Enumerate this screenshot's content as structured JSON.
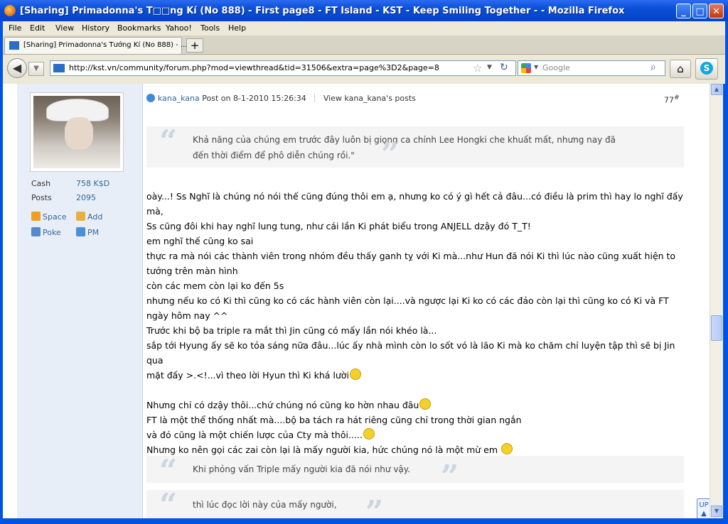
{
  "window": {
    "title": "[Sharing] Primadonna's T□□ng Kí (No 888) - First page8 - FT Island - KST - Keep Smiling Together - - Mozilla Firefox",
    "minimize": "_",
    "maximize": "□",
    "close": "✕"
  },
  "menu": [
    "File",
    "Edit",
    "View",
    "History",
    "Bookmarks",
    "Yahoo!",
    "Tools",
    "Help"
  ],
  "tab": {
    "label": "[Sharing] Primadonna's Tướng Kí (No 888) - ...",
    "new_tab": "+"
  },
  "nav": {
    "url": "http://kst.vn/community/forum.php?mod=viewthread&tid=31506&extra=page%3D2&page=8",
    "search_placeholder": "Google"
  },
  "sidebar": {
    "cash_label": "Cash",
    "cash_value": "758 K$D",
    "posts_label": "Posts",
    "posts_value": "2095",
    "links": [
      "Space",
      "Add",
      "Poke",
      "PM"
    ]
  },
  "post": {
    "author": "kana_kana",
    "posted": "Post on 8-1-2010 15:26:34",
    "view_posts": "View kana_kana's posts",
    "number": "77",
    "number_sup": "#",
    "quote1": [
      "Khả năng của chúng em trước đây luôn bị giọng ca chính Lee Hongki che khuất mất, nhưng nay đã",
      "đến thời điểm để phô diễn chúng rồi.\""
    ],
    "lines": [
      "oày...! Ss Nghĩ là chúng nó nói thế cũng đúng thôi em ạ, nhưng ko có ý gì hết cả đâu...có điều là prim thì hay lo nghĩ đấy",
      "mà,",
      "Ss cũng đôi khi hay nghĩ lung tung, như cái lần Ki phát biểu trong ANJELL dzậy đó T_T!",
      "em nghĩ thế cũng ko sai",
      "thực ra mà nói các thành viên trong nhóm đều thấy ganh tỵ với Ki mà...như Hun đã nói Ki thì lúc nào cũng xuất hiện to",
      "tướng trên màn hình",
      "còn các mem còn lại ko đến 5s",
      "nhưng nếu ko có Ki thì cũng ko có các hành viên còn lại....và ngược lại Ki ko có các đảo còn lại thì cũng ko có Ki và FT",
      "ngày hôm nay ^^",
      "Trước khi bộ ba triple ra mắt thì Jin cũng có mấy lần nói khéo là...",
      "sắp tới Hyung ấy sẽ ko tỏa sáng nữa đâu...lúc ấy nhà mình còn lo sốt vó là lão Ki mà ko chăm chỉ luyện tập thì sẽ bị Jin qua",
      "mặt đấy >.<!...vì theo lời Hyun thì Ki khá lười"
    ],
    "lines2": [
      "Nhưng chỉ có dzậy thôi...chứ chúng nó cũng ko hờn nhau đâu",
      "FT là một thể thống nhất mà....bộ ba tách ra hát riêng cũng chỉ trong thời gian ngắn",
      "và đó cũng là một chiến lược của Cty mà thôi.....",
      "Nhưng ko nên gọi các zai còn lại là mấy người kia, hức chúng nó là một mừ em"
    ],
    "quote2": "Khi phỏng vấn Triple mấy người kia đã nói như vậy.",
    "quote3": "thì lúc đọc lời này của mấy người,"
  },
  "side_tool": {
    "label": "UP"
  }
}
